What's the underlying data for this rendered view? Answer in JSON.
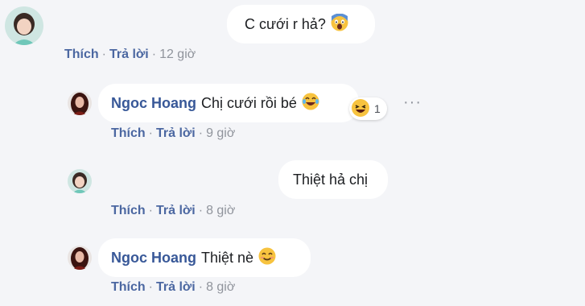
{
  "comments": [
    {
      "author": "",
      "text": "C cưới r hả?",
      "emoji": "fear-face-emoji",
      "like_label": "Thích",
      "reply_label": "Trả lời",
      "time": "12 giờ"
    },
    {
      "author": "Ngoc Hoang",
      "text": "Chị cưới rồi bé",
      "emoji": "tears-of-joy-emoji",
      "reaction": {
        "icon": "haha-reaction-icon",
        "count": "1"
      },
      "more_icon": "more-options-icon",
      "more_glyph": "···",
      "like_label": "Thích",
      "reply_label": "Trả lời",
      "time": "9 giờ"
    },
    {
      "author": "",
      "text": "Thiệt hả chị",
      "like_label": "Thích",
      "reply_label": "Trả lời",
      "time": "8 giờ"
    },
    {
      "author": "Ngoc Hoang",
      "text": "Thiệt nè",
      "emoji": "smiling-face-emoji",
      "like_label": "Thích",
      "reply_label": "Trả lời",
      "time": "8 giờ"
    }
  ],
  "separator": "·",
  "colors": {
    "background": "#f4f5f8",
    "bubble": "#ffffff",
    "author": "#385898",
    "action_link": "#4b67a1",
    "meta": "#90949c",
    "emoji_yellow": "#f7c33f"
  }
}
